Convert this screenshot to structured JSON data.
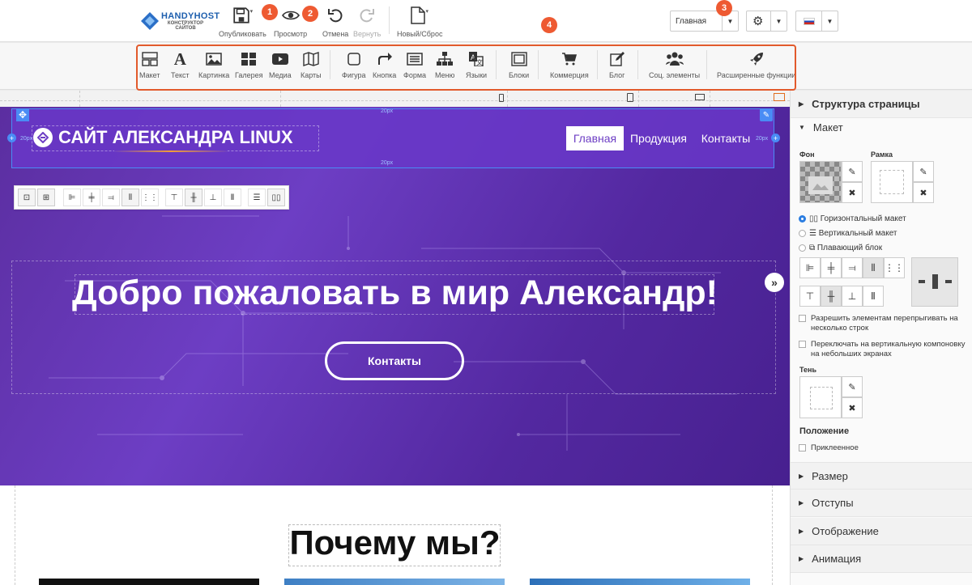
{
  "logo": {
    "name": "HANDYHOST",
    "tagline": "КОНСТРУКТОР САЙТОВ"
  },
  "topbar": {
    "publish": "Опубликовать",
    "preview": "Просмотр",
    "undo": "Отмена",
    "redo": "Вернуть",
    "new_reset": "Новый/Сброс",
    "page_select": "Главная",
    "badges": [
      "1",
      "2",
      "3",
      "4"
    ]
  },
  "tools": [
    "Макет",
    "Текст",
    "Картинка",
    "Галерея",
    "Медиа",
    "Карты",
    "Фигура",
    "Кнопка",
    "Форма",
    "Меню",
    "Языки",
    "Блоки",
    "Коммерция",
    "Блог",
    "Соц. элементы",
    "Расширенные функции"
  ],
  "site": {
    "brand": "САЙТ АЛЕКСАНДРА LINUX",
    "nav": [
      "Главная",
      "Продукция",
      "Контакты"
    ],
    "hero_title": "Добро пожаловать в мир Александр!",
    "hero_button": "Контакты",
    "section_title": "Почему мы?",
    "padding_label": "20px"
  },
  "panel": {
    "structure": "Структура страницы",
    "layout": "Макет",
    "bg_label": "Фон",
    "border_label": "Рамка",
    "layout_options": [
      "Горизонтальный макет",
      "Вертикальный макет",
      "Плавающий блок"
    ],
    "wrap_option": "Разрешить элементам перепрыгивать на несколько строк",
    "vertical_option": "Переключать на вертикальную компоновку на небольших экранах",
    "shadow_label": "Тень",
    "position_label": "Положение",
    "sticky_option": "Приклеенное",
    "sections": [
      "Размер",
      "Отступы",
      "Отображение",
      "Анимация"
    ]
  },
  "colors": {
    "accent": "#e25a2c",
    "badge": "#ee5a32",
    "hero": "#6d3ec4",
    "selection": "#4a8cf5"
  }
}
